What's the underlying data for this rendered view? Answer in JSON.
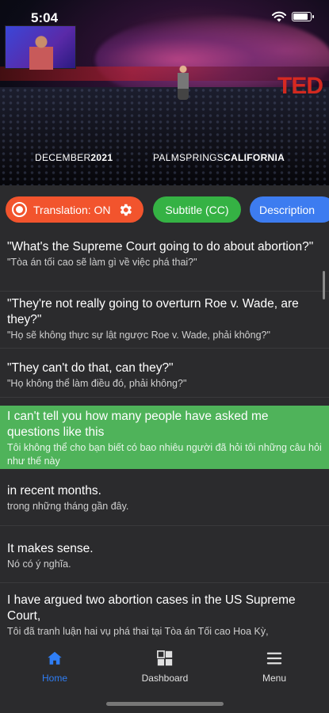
{
  "status_bar": {
    "time": "5:04"
  },
  "video": {
    "logo": "TED",
    "venue_date_light": "DECEMBER",
    "venue_date_bold": "2021",
    "venue_place_light": "PALMSPRINGS",
    "venue_place_bold": "CALIFORNIA"
  },
  "controls": {
    "translation_label": "Translation: ON",
    "subtitle_label": "Subtitle (CC)",
    "description_label": "Description"
  },
  "transcript": [
    {
      "en": "\"What's the Supreme Court going to do about abortion?\"",
      "vi": "\"Tòa án tối cao sẽ làm gì về việc phá thai?\""
    },
    {
      "en": "\"They're not really going to overturn Roe v. Wade, are they?\"",
      "vi": "\"Họ sẽ không thực sự lật ngược Roe v. Wade, phải không?\""
    },
    {
      "en": "\"They can't do that, can they?\"",
      "vi": "\"Họ không thể làm điều đó, phải không?\""
    },
    {
      "en": "I can't tell you how many people have asked me questions like this",
      "vi": "Tôi không thể cho bạn biết có bao nhiêu người đã hỏi tôi những câu hỏi như thế này"
    },
    {
      "en": "in recent months.",
      "vi": "trong những tháng gần đây."
    },
    {
      "en": "It makes sense.",
      "vi": "Nó có ý nghĩa."
    },
    {
      "en": "I have argued two abortion cases in the US Supreme Court,",
      "vi": "Tôi đã tranh luận hai vụ phá thai tại Tòa án Tối cao Hoa Kỳ,"
    }
  ],
  "tabs": {
    "home": "Home",
    "dashboard": "Dashboard",
    "menu": "Menu"
  },
  "colors": {
    "accent_blue": "#2f7ef5",
    "translation_orange": "#f2542d",
    "subtitle_green": "#35b244",
    "description_blue": "#3d7cf0",
    "active_line_green": "#4fb35a"
  }
}
